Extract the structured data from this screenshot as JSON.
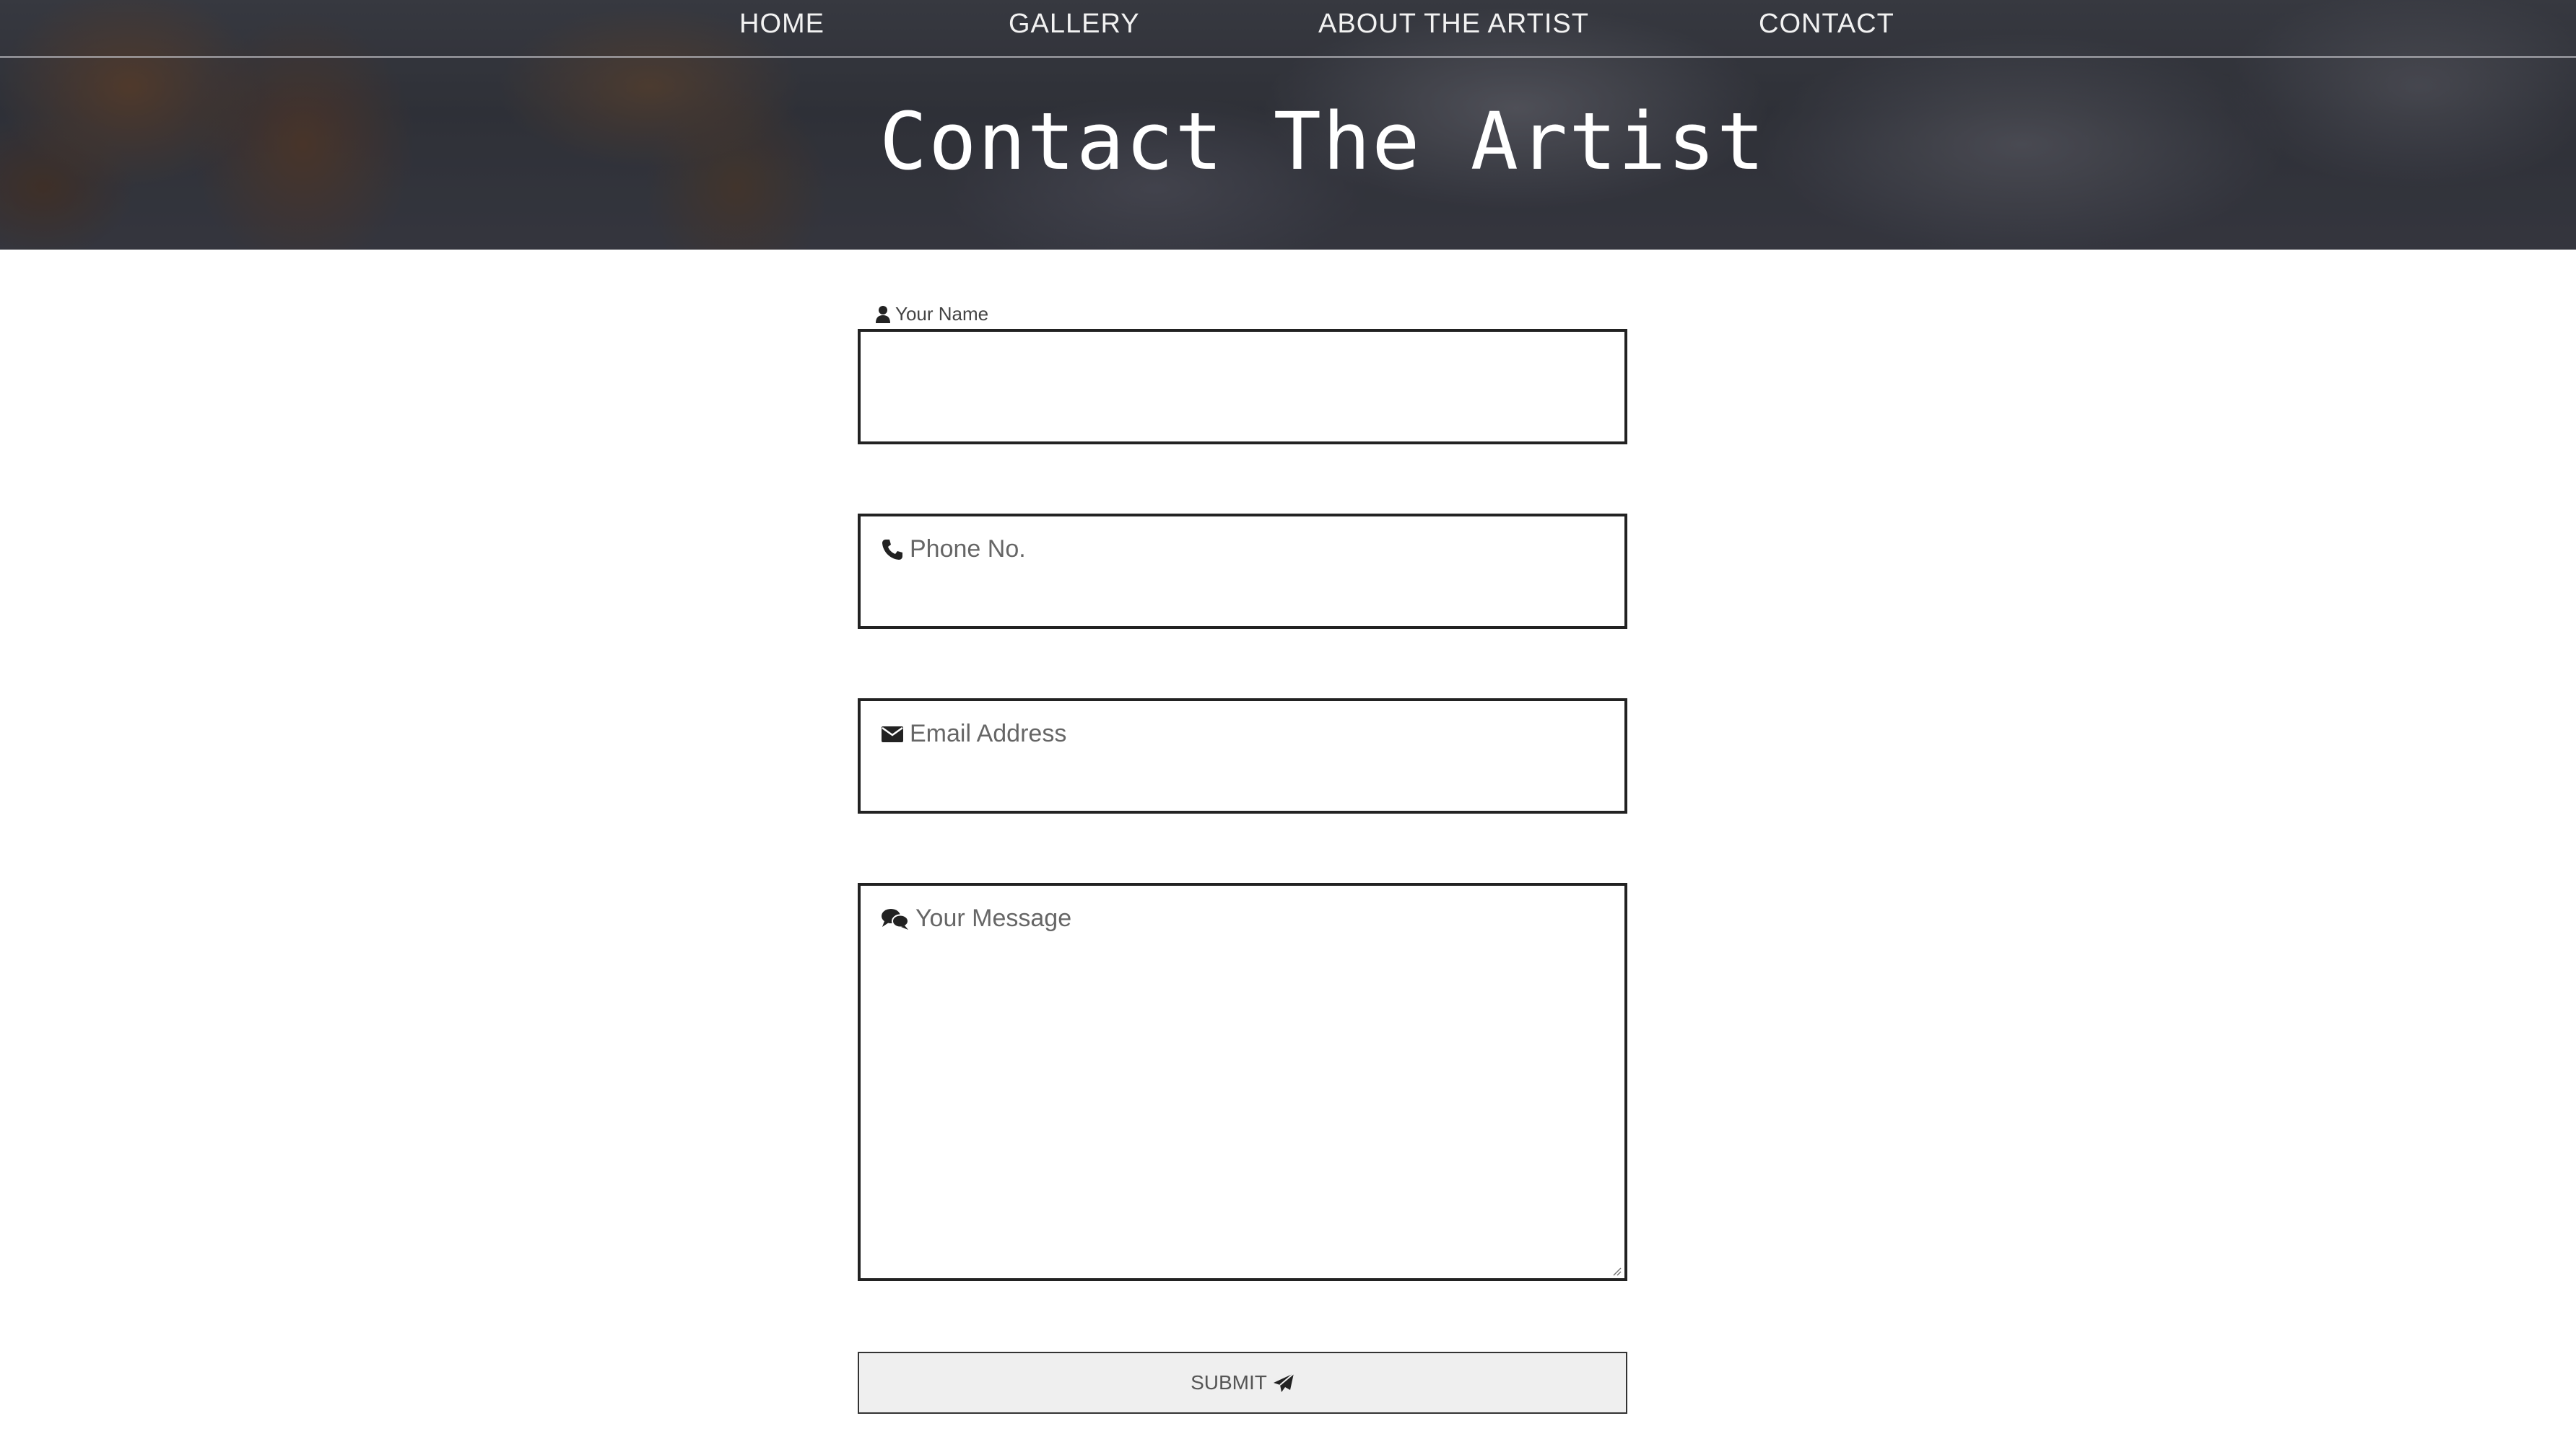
{
  "nav": {
    "items": [
      {
        "label": "HOME"
      },
      {
        "label": "GALLERY"
      },
      {
        "label": "ABOUT THE ARTIST"
      },
      {
        "label": "CONTACT"
      }
    ]
  },
  "hero": {
    "title": "Contact The Artist"
  },
  "form": {
    "name": {
      "label": "Your Name",
      "icon": "user-icon",
      "value": ""
    },
    "phone": {
      "placeholder": "Phone No.",
      "icon": "phone-icon",
      "value": ""
    },
    "email": {
      "placeholder": "Email Address",
      "icon": "envelope-icon",
      "value": ""
    },
    "message": {
      "placeholder": "Your Message",
      "icon": "chat-icon",
      "value": ""
    },
    "submit": {
      "label": "SUBMIT",
      "icon": "paper-plane-icon"
    }
  },
  "colors": {
    "field_border": "#222222",
    "submit_background": "#efefef",
    "nav_text": "#f2f2f2"
  }
}
